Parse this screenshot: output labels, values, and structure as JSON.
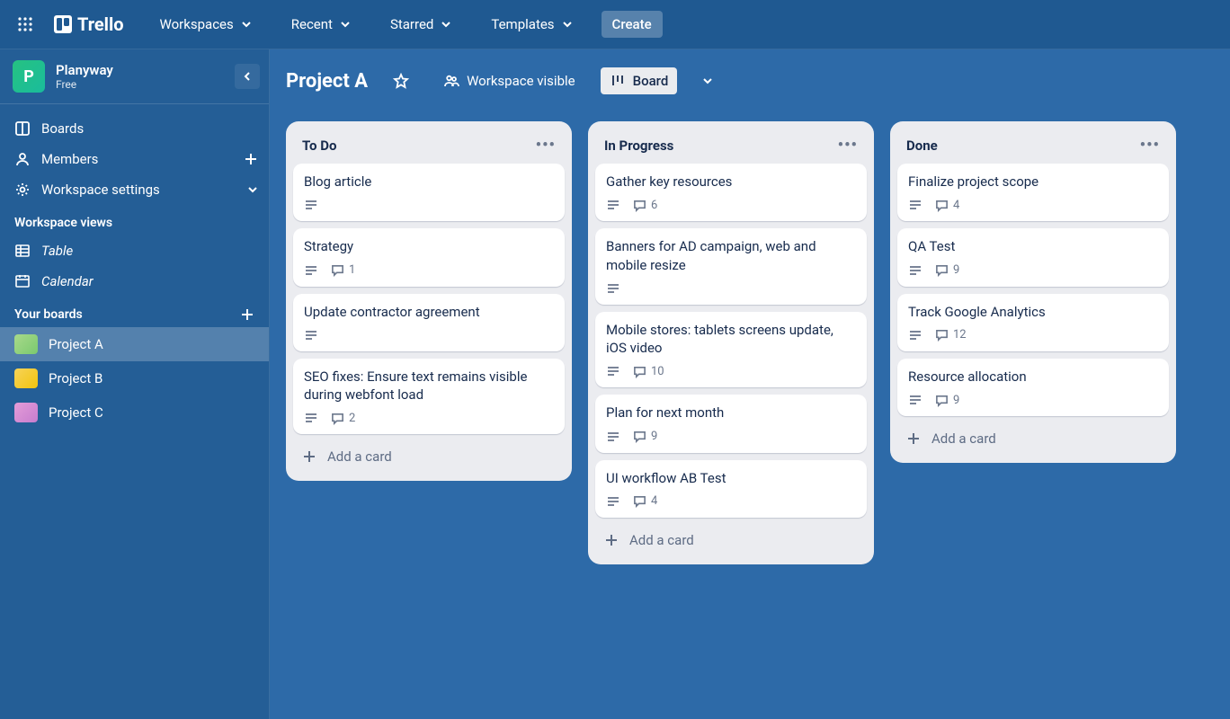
{
  "topnav": {
    "brand": "Trello",
    "items": [
      "Workspaces",
      "Recent",
      "Starred",
      "Templates"
    ],
    "create": "Create"
  },
  "workspace": {
    "name": "Planyway",
    "plan": "Free",
    "initial": "P"
  },
  "sidebar": {
    "boards": "Boards",
    "members": "Members",
    "settings": "Workspace settings",
    "views_header": "Workspace views",
    "table": "Table",
    "calendar": "Calendar",
    "your_boards": "Your boards",
    "boards_list": [
      {
        "name": "Project A",
        "color": "linear-gradient(135deg,#a8d98a,#7bc96f)",
        "active": true
      },
      {
        "name": "Project B",
        "color": "linear-gradient(135deg,#f7d358,#f1c40f)",
        "active": false
      },
      {
        "name": "Project C",
        "color": "linear-gradient(135deg,#e49cd8,#c77dce)",
        "active": false
      }
    ]
  },
  "board": {
    "title": "Project A",
    "visibility": "Workspace visible",
    "view_label": "Board"
  },
  "lists": [
    {
      "name": "To Do",
      "cards": [
        {
          "title": "Blog article",
          "desc": true
        },
        {
          "title": "Strategy",
          "desc": true,
          "comments": 1
        },
        {
          "title": "Update contractor agreement",
          "desc": true
        },
        {
          "title": "SEO fixes: Ensure text remains visible during webfont load",
          "desc": true,
          "comments": 2
        }
      ]
    },
    {
      "name": "In Progress",
      "cards": [
        {
          "title": "Gather key resources",
          "desc": true,
          "comments": 6
        },
        {
          "title": "Banners for AD campaign, web and mobile resize",
          "desc": true
        },
        {
          "title": "Mobile stores: tablets screens update, iOS video",
          "desc": true,
          "comments": 10
        },
        {
          "title": "Plan for next month",
          "desc": true,
          "comments": 9
        },
        {
          "title": "UI workflow AB Test",
          "desc": true,
          "comments": 4
        }
      ]
    },
    {
      "name": "Done",
      "cards": [
        {
          "title": "Finalize project scope",
          "desc": true,
          "comments": 4
        },
        {
          "title": "QA Test",
          "desc": true,
          "comments": 9
        },
        {
          "title": "Track Google Analytics",
          "desc": true,
          "comments": 12
        },
        {
          "title": "Resource allocation",
          "desc": true,
          "comments": 9
        }
      ]
    }
  ],
  "labels": {
    "add_card": "Add a card"
  }
}
